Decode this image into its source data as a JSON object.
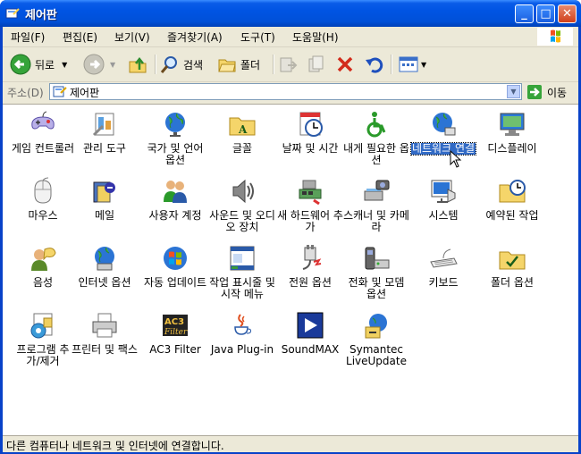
{
  "window": {
    "title": "제어판",
    "min_label": "_",
    "max_label": "□",
    "close_label": "✕"
  },
  "menu": [
    "파일(F)",
    "편집(E)",
    "보기(V)",
    "즐겨찾기(A)",
    "도구(T)",
    "도움말(H)"
  ],
  "toolbar": {
    "back_label": "뒤로",
    "search_label": "검색",
    "folders_label": "폴더"
  },
  "address": {
    "label": "주소(D)",
    "value": "제어판",
    "go_label": "이동"
  },
  "items": [
    {
      "label": "게임 컨트롤러",
      "icon": "game-controller-icon"
    },
    {
      "label": "관리 도구",
      "icon": "admin-tools-icon"
    },
    {
      "label": "국가 및 언어 옵션",
      "icon": "globe-icon"
    },
    {
      "label": "글꼴",
      "icon": "fonts-folder-icon"
    },
    {
      "label": "날짜 및 시간",
      "icon": "clock-icon"
    },
    {
      "label": "내게 필요한 옵션",
      "icon": "accessibility-icon"
    },
    {
      "label": "네트워크 연결",
      "icon": "network-globe-icon"
    },
    {
      "label": "디스플레이",
      "icon": "display-icon"
    },
    {
      "label": "마우스",
      "icon": "mouse-icon"
    },
    {
      "label": "메일",
      "icon": "mail-icon"
    },
    {
      "label": "사용자 계정",
      "icon": "users-icon"
    },
    {
      "label": "사운드 및 오디오 장치",
      "icon": "speaker-icon"
    },
    {
      "label": "새 하드웨어 추가",
      "icon": "hardware-icon"
    },
    {
      "label": "스캐너 및 카메라",
      "icon": "scanner-icon"
    },
    {
      "label": "시스템",
      "icon": "system-icon"
    },
    {
      "label": "예약된 작업",
      "icon": "scheduled-tasks-icon"
    },
    {
      "label": "음성",
      "icon": "speech-icon"
    },
    {
      "label": "인터넷 옵션",
      "icon": "internet-options-icon"
    },
    {
      "label": "자동 업데이트",
      "icon": "windows-update-icon"
    },
    {
      "label": "작업 표시줄 및 시작 메뉴",
      "icon": "taskbar-icon"
    },
    {
      "label": "전원 옵션",
      "icon": "power-icon"
    },
    {
      "label": "전화 및 모뎀 옵션",
      "icon": "phone-modem-icon"
    },
    {
      "label": "키보드",
      "icon": "keyboard-icon"
    },
    {
      "label": "폴더 옵션",
      "icon": "folder-options-icon"
    },
    {
      "label": "프로그램 추가/제거",
      "icon": "add-remove-icon"
    },
    {
      "label": "프린터 및 팩스",
      "icon": "printer-icon"
    },
    {
      "label": "AC3 Filter",
      "icon": "ac3-filter-icon"
    },
    {
      "label": "Java Plug-in",
      "icon": "java-icon"
    },
    {
      "label": "SoundMAX",
      "icon": "soundmax-icon"
    },
    {
      "label": "Symantec LiveUpdate",
      "icon": "liveupdate-icon"
    }
  ],
  "selected_index": 6,
  "status": {
    "text": "다른 컴퓨터나 네트워크 및 인터넷에 연결합니다."
  },
  "colors": {
    "titlebar": "#0054e3",
    "selection": "#316ac5",
    "chrome": "#ece9d8"
  }
}
